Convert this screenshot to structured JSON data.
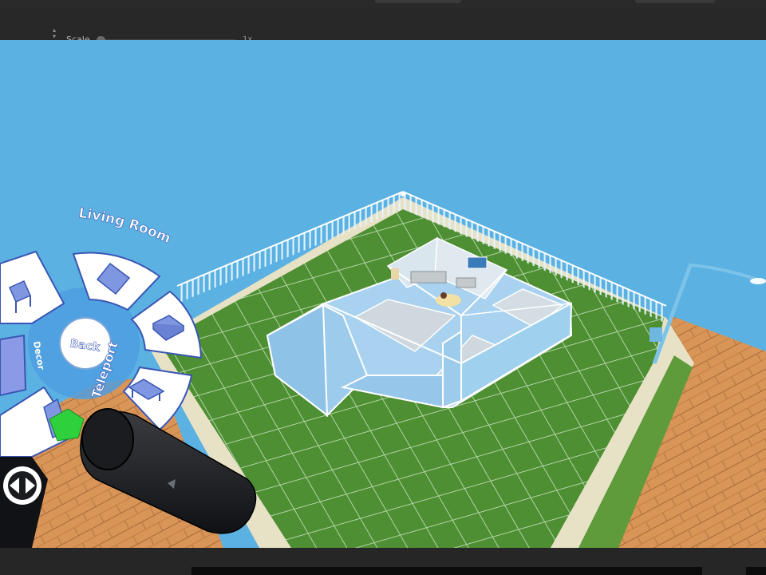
{
  "toolbar": {
    "scale_label": "Scale",
    "scale_value": "1x",
    "scale_slider_fraction": 0.03
  },
  "menu": {
    "title": "Living Room",
    "back_label": "Back",
    "teleport_label": "Teleport",
    "decor_label": "Decor",
    "items": [
      "chair-icon",
      "rug-icon",
      "sofa-icon",
      "coffee-table-icon",
      "lamp-icon"
    ]
  },
  "colors": {
    "sky": "#5ab1e2",
    "grass": "#4d8f32",
    "walls": "#a8d2ef",
    "wood": "#d99557",
    "menu_accent": "#3a56b4"
  }
}
